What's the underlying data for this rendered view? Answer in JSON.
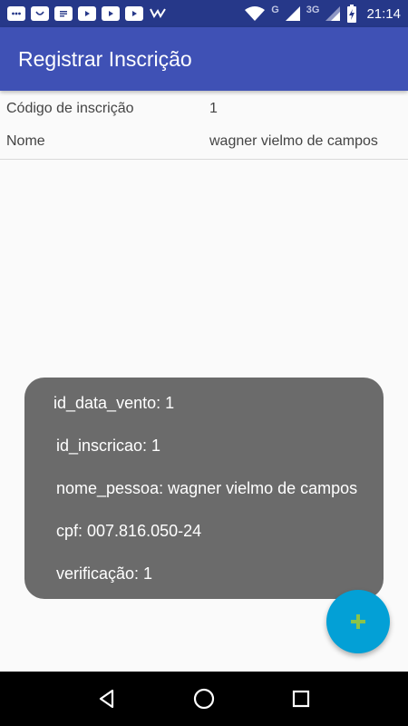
{
  "status_bar": {
    "time": "21:14",
    "network_1": "G",
    "network_2": "3G",
    "icons": [
      "message-icon",
      "face-icon",
      "document-icon",
      "youtube-icon",
      "youtube-icon",
      "youtube-icon",
      "check-icon",
      "wifi-icon",
      "signal-icon",
      "signal-icon",
      "battery-charging-icon"
    ]
  },
  "app_bar": {
    "title": "Registrar Inscrição"
  },
  "details": {
    "rows": [
      {
        "label": "Código de inscrição",
        "value": "1"
      },
      {
        "label": "Nome",
        "value": "wagner vielmo de campos"
      }
    ]
  },
  "toast": {
    "lines": [
      "id_data_vento: 1",
      "id_inscricao: 1",
      "nome_pessoa: wagner vielmo de campos",
      "cpf: 007.816.050-24",
      "verificação: 1"
    ]
  },
  "fab": {
    "icon": "plus-icon",
    "icon_color": "#8bc34a",
    "color": "#03a0d6"
  },
  "nav_bar": {
    "icons": [
      "back-icon",
      "home-icon",
      "recents-icon"
    ]
  },
  "colors": {
    "primary": "#3f51b5",
    "status_bar": "#263889"
  }
}
